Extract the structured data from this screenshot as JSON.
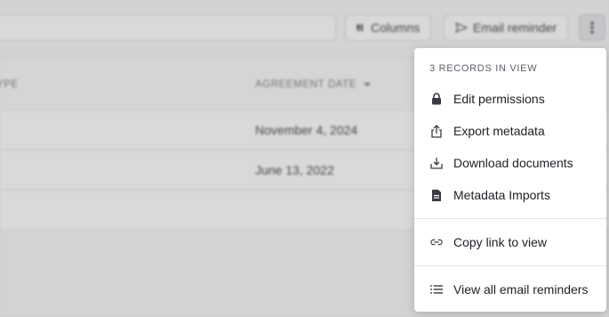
{
  "toolbar": {
    "columns_label": "Columns",
    "email_reminder_label": "Email reminder"
  },
  "table": {
    "headers": [
      "YPE",
      "AGREEMENT DATE"
    ],
    "rows": [
      {
        "agreement_date": "November 4, 2024"
      },
      {
        "agreement_date": "June 13, 2022"
      }
    ]
  },
  "menu": {
    "header": "3 RECORDS IN VIEW",
    "items": [
      {
        "label": "Edit permissions",
        "icon": "lock-icon"
      },
      {
        "label": "Export metadata",
        "icon": "share-upload-icon"
      },
      {
        "label": "Download documents",
        "icon": "download-tray-icon"
      },
      {
        "label": "Metadata Imports",
        "icon": "document-icon"
      },
      {
        "label": "Copy link to view",
        "icon": "link-icon"
      },
      {
        "label": "View all email reminders",
        "icon": "list-icon"
      }
    ]
  },
  "colors": {
    "backdrop": "#f7f7f8",
    "menu_bg": "#ffffff",
    "text": "#1f1f26",
    "muted": "#6b6b75"
  }
}
